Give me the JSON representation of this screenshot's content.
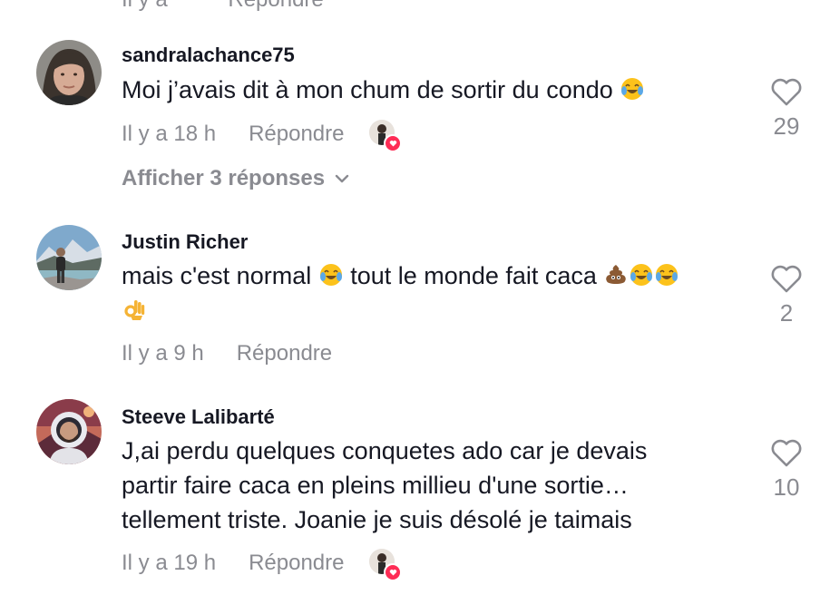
{
  "top_partial": {
    "time": "Il y a",
    "reply": "Répondre"
  },
  "comments": [
    {
      "username": "sandralachance75",
      "text_before": "Moi j’avais dit à mon chum de sortir du condo",
      "emojis": [
        "face-with-tears-of-joy"
      ],
      "time": "Il y a 18 h",
      "reply_label": "Répondre",
      "creator_liked": true,
      "likes": "29",
      "show_replies": "Afficher 3 réponses"
    },
    {
      "username": "Justin Richer",
      "text_part1": "mais c'est normal",
      "text_part2": "tout le monde fait caca",
      "emojis": [
        "face-with-tears-of-joy",
        "pile-of-poo",
        "face-with-tears-of-joy",
        "face-with-tears-of-joy",
        "ok-hand"
      ],
      "time": "Il y a 9 h",
      "reply_label": "Répondre",
      "creator_liked": false,
      "likes": "2"
    },
    {
      "username": "Steeve Lalibarté",
      "text": "J,ai perdu quelques conquetes ado car je devais partir faire caca en pleins millieu d'une sortie… tellement triste. Joanie je suis désolé je taimais",
      "time": "Il y a 19 h",
      "reply_label": "Répondre",
      "creator_liked": true,
      "likes": "10"
    }
  ],
  "colors": {
    "text": "#161823",
    "muted": "#8a8b91",
    "heart_badge": "#fe2c55"
  },
  "icons": {
    "like": "heart-outline-icon",
    "expand": "chevron-down-icon",
    "creator_like": "creator-liked-badge-icon"
  }
}
